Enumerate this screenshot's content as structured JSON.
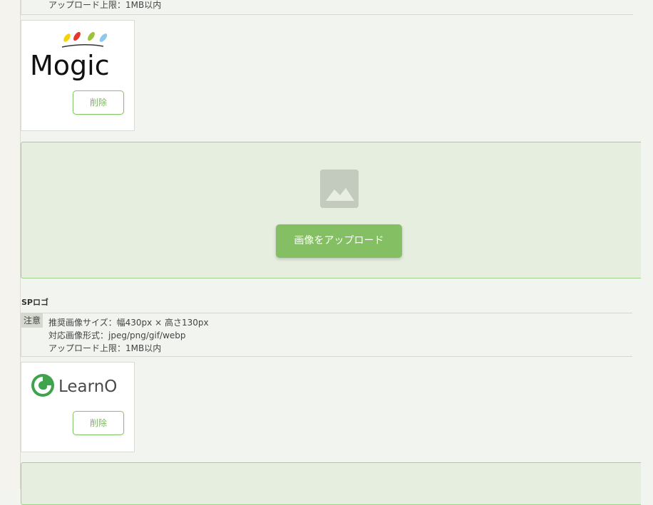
{
  "main_logo": {
    "note_last_line": "アップロード上限：1MB以内",
    "logo_alt": "Mogic",
    "delete_label": "削除"
  },
  "upload": {
    "button_label": "画像をアップロード",
    "icon": "image-placeholder-icon"
  },
  "sp_logo": {
    "section_title": "SPロゴ",
    "note_badge": "注意",
    "note_lines": [
      "推奨画像サイズ：幅430px × 高さ130px",
      "対応画像形式：jpeg/png/gif/webp",
      "アップロード上限：1MB以内"
    ],
    "logo_alt": "LearnO",
    "delete_label": "削除"
  },
  "colors": {
    "accent": "#84c063",
    "zone_bg": "#e6eee0",
    "zone_border": "#9fd18a",
    "page_bg": "#f2f4ef"
  }
}
